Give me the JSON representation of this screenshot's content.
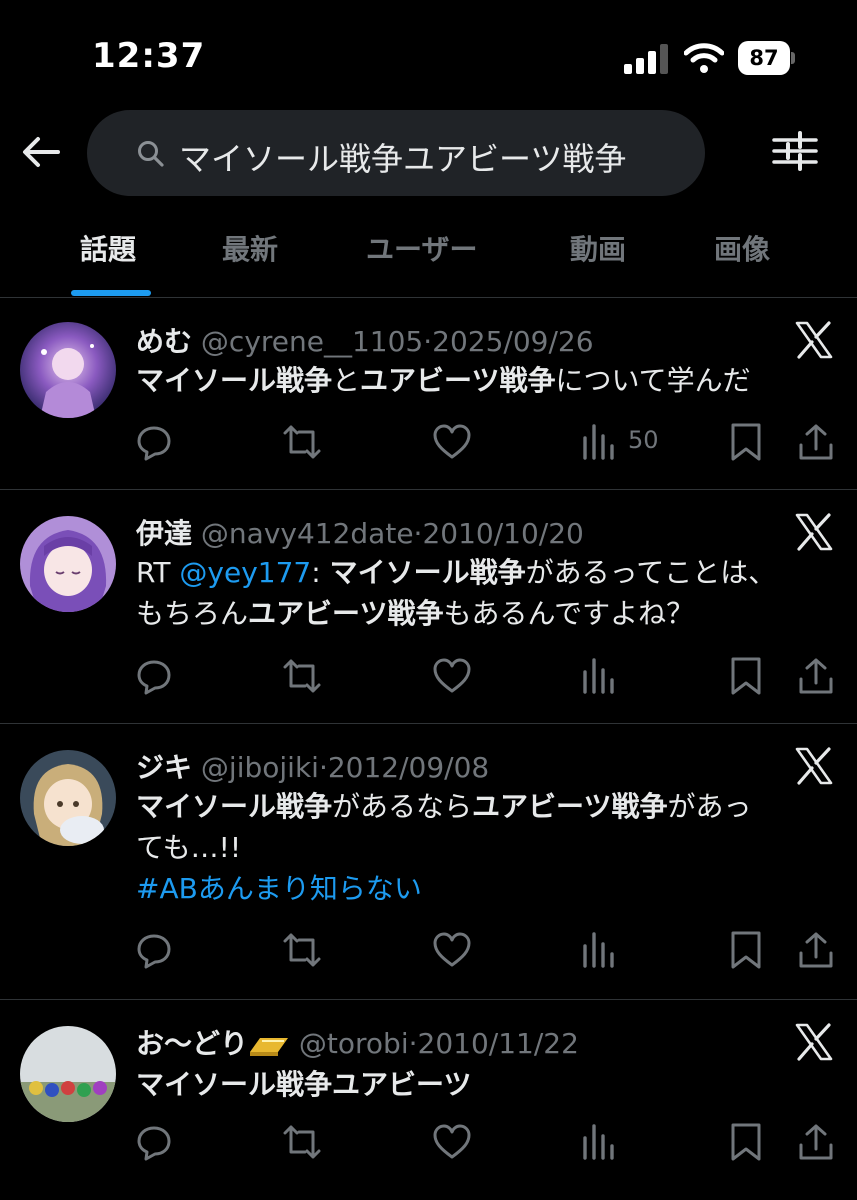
{
  "status": {
    "time": "12:37",
    "battery": "87"
  },
  "search": {
    "query": "マイソール戦争ユアビーツ戦争"
  },
  "tabs": [
    "話題",
    "最新",
    "ユーザー",
    "動画",
    "画像"
  ],
  "colors": {
    "accent": "#1d9bf0",
    "muted": "#71767b",
    "text": "#e7e9ea",
    "background": "#000000"
  },
  "posts": [
    {
      "name": "めむ",
      "handle": "@cyrene__1105",
      "date": "2025/09/26",
      "body": {
        "p1": "マイソール戦争",
        "p2": "と",
        "p3": "ユアビーツ戦争",
        "p4": "について学んだ"
      },
      "views": "50"
    },
    {
      "name": "伊達",
      "handle": "@navy412date",
      "date": "2010/10/20",
      "body": {
        "rt": "RT ",
        "mention": "@yey177",
        "colon": ": ",
        "p1": "マイソール戦争",
        "p2": "があるってことは、",
        "p3": "もちろん",
        "p4": "ユアビーツ戦争",
        "p5": "もあるんですよね？"
      }
    },
    {
      "name": "ジキ",
      "handle": "@jibojiki",
      "date": "2012/09/08",
      "body": {
        "p1": "マイソール戦争",
        "p2": "があるなら",
        "p3": "ユアビーツ戦争",
        "p4": "があっ",
        "p5": "ても…!!",
        "hashtag": "#ABあんまり知らない"
      }
    },
    {
      "name": "お〜どり",
      "handle": "@torobi",
      "date": "2010/11/22",
      "body": {
        "p1": "マイソール戦争ユアビーツ"
      }
    }
  ],
  "icons": [
    "back-arrow-icon",
    "search-icon",
    "filter-icon",
    "x-logo-icon",
    "reply-icon",
    "repost-icon",
    "like-icon",
    "views-icon",
    "bookmark-icon",
    "share-icon",
    "gold-bar-icon"
  ]
}
